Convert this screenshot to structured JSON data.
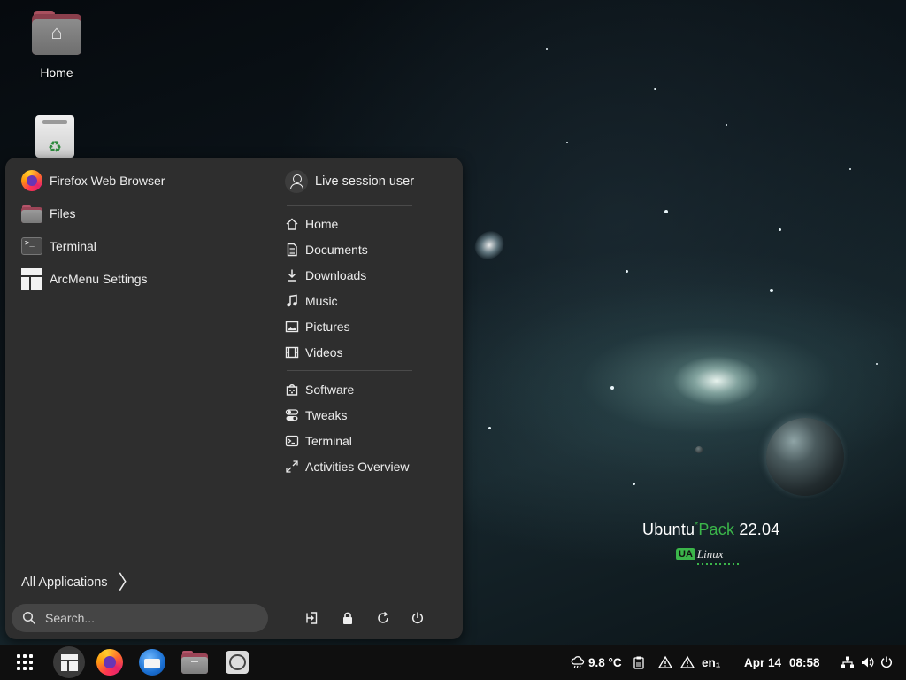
{
  "desktop": {
    "icons": [
      {
        "label": "Home",
        "icon": "home-folder-icon"
      },
      {
        "label": "",
        "icon": "trash-icon"
      }
    ],
    "brand": {
      "part1": "Ubuntu",
      "sup": "*",
      "part2": "Pack",
      "version": "22.04"
    },
    "ualinux": {
      "badge": "UA",
      "text": "Linux"
    }
  },
  "menu": {
    "pinned_apps": [
      {
        "label": "Firefox Web Browser",
        "icon": "firefox-icon"
      },
      {
        "label": "Files",
        "icon": "files-folder-icon"
      },
      {
        "label": "Terminal",
        "icon": "terminal-icon"
      },
      {
        "label": "ArcMenu Settings",
        "icon": "arcmenu-icon"
      }
    ],
    "user": {
      "label": "Live session user",
      "icon": "user-avatar-icon"
    },
    "places": [
      {
        "label": "Home",
        "icon": "home-icon"
      },
      {
        "label": "Documents",
        "icon": "document-icon"
      },
      {
        "label": "Downloads",
        "icon": "download-icon"
      },
      {
        "label": "Music",
        "icon": "music-note-icon"
      },
      {
        "label": "Pictures",
        "icon": "picture-icon"
      },
      {
        "label": "Videos",
        "icon": "film-icon"
      }
    ],
    "shortcuts": [
      {
        "label": "Software",
        "icon": "software-icon"
      },
      {
        "label": "Tweaks",
        "icon": "tweaks-icon"
      },
      {
        "label": "Terminal",
        "icon": "terminal-icon"
      },
      {
        "label": "Activities Overview",
        "icon": "expand-arrows-icon"
      }
    ],
    "all_apps_label": "All Applications",
    "search_placeholder": "Search...",
    "power_actions": [
      "logout-icon",
      "lock-icon",
      "restart-icon",
      "power-icon"
    ]
  },
  "taskbar": {
    "apps": [
      "app-grid-icon",
      "arcmenu-icon",
      "firefox-icon",
      "thunderbird-icon",
      "files-icon",
      "chat-icon"
    ],
    "weather": "9.8 °C",
    "keyboard_layout": "en₁",
    "date": "Apr 14",
    "time": "08:58"
  },
  "colors": {
    "menu_bg": "#2e2e2e",
    "taskbar_bg": "#0f0f0f",
    "brand_green": "#3bb54a",
    "search_bg": "#454545"
  }
}
